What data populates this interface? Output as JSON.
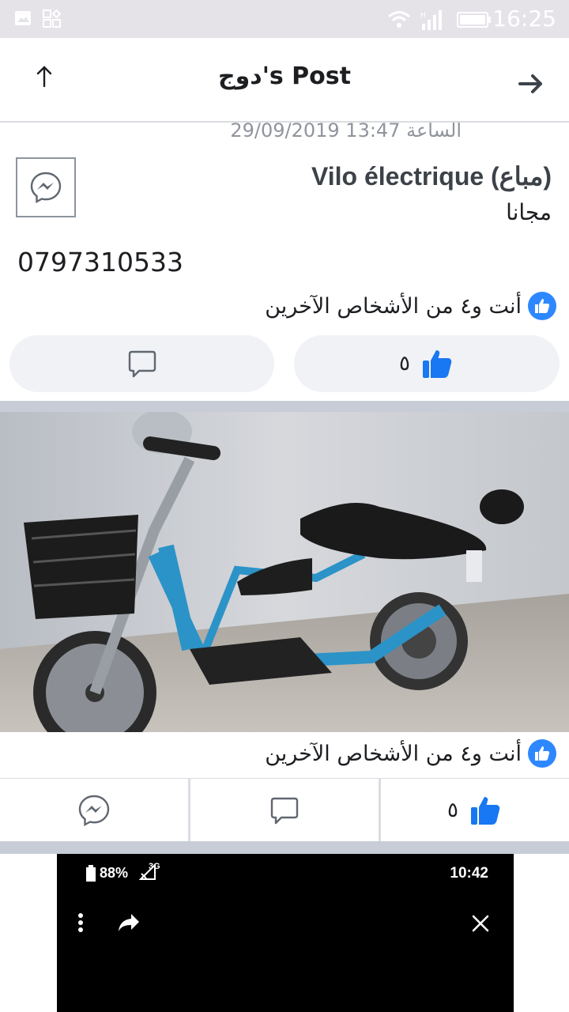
{
  "status_bar": {
    "time": "16:25",
    "icons": [
      "image-icon",
      "apps-icon",
      "wifi-icon",
      "signal-icon",
      "battery-icon"
    ]
  },
  "header": {
    "title": "دوج's Post",
    "back_icon": "arrow-up-icon",
    "forward_icon": "arrow-right-icon"
  },
  "post": {
    "timestamp": "29/09/2019 الساعة 13:47",
    "title": "Vilo électrique (مباع)",
    "price": "مجانا",
    "body": "0797310533",
    "reactions_text": "أنت و٤ من الأشخاص الآخرين",
    "like_count": "٥"
  },
  "photo": {
    "reactions_text": "أنت و٤ من الأشخاص الآخرين",
    "like_count": "٥"
  },
  "embedded": {
    "battery": "88%",
    "network": "3G",
    "time": "10:42"
  },
  "colors": {
    "accent": "#2d88ff",
    "like_blue": "#1877f2",
    "pill_bg": "#f0f2f5",
    "separator": "#c8ccd6"
  }
}
